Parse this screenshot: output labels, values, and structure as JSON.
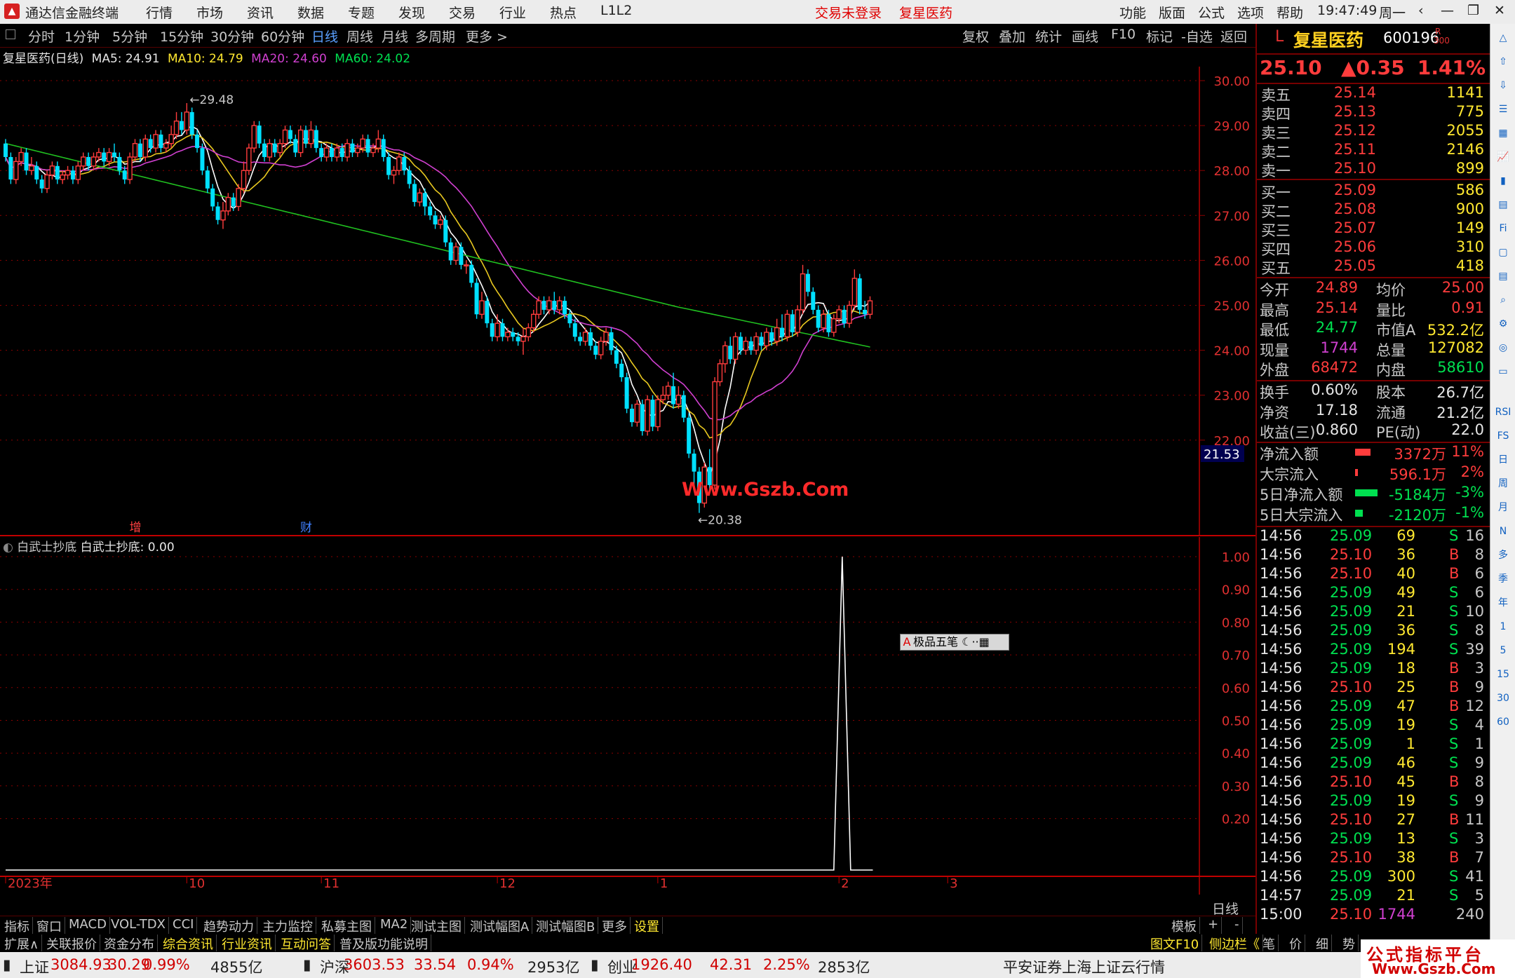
{
  "window": {
    "app_title": "通达信金融终端",
    "menu": [
      "行情",
      "市场",
      "资讯",
      "数据",
      "专题",
      "发现",
      "交易",
      "行业",
      "热点",
      "L1L2"
    ],
    "status_center": [
      "交易未登录",
      "复星医药"
    ],
    "menu_right": [
      "功能",
      "版面",
      "公式",
      "选项",
      "帮助"
    ],
    "time": "19:47:49",
    "weekday": "周一"
  },
  "toolbar": {
    "periods": [
      "分时",
      "1分钟",
      "5分钟",
      "15分钟",
      "30分钟",
      "60分钟",
      "日线",
      "周线",
      "月线",
      "多周期",
      "更多 >"
    ],
    "active_period": "日线",
    "right": [
      "复权",
      "叠加",
      "统计",
      "画线",
      "F10",
      "标记",
      "-自选",
      "返回"
    ]
  },
  "chart_header": {
    "name": "复星医药(日线)",
    "ma5": "MA5: 24.91",
    "ma10": "MA10: 24.79",
    "ma20": "MA20: 24.60",
    "ma60": "MA60: 24.02"
  },
  "indicator_header": {
    "name": "白武士抄底",
    "value": "白武士抄底: 0.00"
  },
  "colors": {
    "up": "#ff3c3c",
    "down": "#00e0ff",
    "ma5": "#ffffff",
    "ma10": "#e8c820",
    "ma20": "#d040d0",
    "ma60": "#20c020",
    "grid": "#8b0000"
  },
  "chart_data": {
    "type": "candlestick",
    "ylim": [
      20.0,
      30.3
    ],
    "y_ticks": [
      "30.00",
      "29.00",
      "28.00",
      "27.00",
      "26.00",
      "25.00",
      "24.00",
      "23.00",
      "22.00"
    ],
    "x_labels": [
      "2023年",
      "10",
      "11",
      "12",
      "1",
      "2",
      "3"
    ],
    "x_label_idx": [
      0,
      35,
      61,
      95,
      126,
      161,
      182
    ],
    "high_label": "29.48",
    "low_label": "20.38",
    "current_price_tag": "21.53",
    "markers": [
      {
        "text": "增",
        "idx": 25
      },
      {
        "text": "财",
        "idx": 58
      }
    ],
    "series_ohlc": [
      [
        28.6,
        28.3,
        28.7,
        28.2
      ],
      [
        28.3,
        27.8,
        28.4,
        27.7
      ],
      [
        27.8,
        28.2,
        28.3,
        27.7
      ],
      [
        28.2,
        28.4,
        28.5,
        28.1
      ],
      [
        28.4,
        28.0,
        28.5,
        27.9
      ],
      [
        28.0,
        28.1,
        28.3,
        27.9
      ],
      [
        28.1,
        27.8,
        28.2,
        27.7
      ],
      [
        27.8,
        27.6,
        27.9,
        27.5
      ],
      [
        27.6,
        27.9,
        28.0,
        27.5
      ],
      [
        27.9,
        28.1,
        28.2,
        27.8
      ],
      [
        28.1,
        27.8,
        28.2,
        27.7
      ],
      [
        27.8,
        27.9,
        28.0,
        27.7
      ],
      [
        27.9,
        28.0,
        28.1,
        27.8
      ],
      [
        28.0,
        27.8,
        28.1,
        27.7
      ],
      [
        27.8,
        28.1,
        28.2,
        27.7
      ],
      [
        28.1,
        28.3,
        28.4,
        28.0
      ],
      [
        28.3,
        28.1,
        28.4,
        28.0
      ],
      [
        28.1,
        28.3,
        28.4,
        28.0
      ],
      [
        28.3,
        28.4,
        28.5,
        28.2
      ],
      [
        28.4,
        28.2,
        28.5,
        28.1
      ],
      [
        28.2,
        28.4,
        28.5,
        28.1
      ],
      [
        28.4,
        28.3,
        28.6,
        28.2
      ],
      [
        28.3,
        28.0,
        28.4,
        27.9
      ],
      [
        28.0,
        27.8,
        28.1,
        27.7
      ],
      [
        27.8,
        28.3,
        28.4,
        27.7
      ],
      [
        28.3,
        28.6,
        28.7,
        28.2
      ],
      [
        28.6,
        28.3,
        28.7,
        28.2
      ],
      [
        28.3,
        28.7,
        28.8,
        28.2
      ],
      [
        28.7,
        28.5,
        28.8,
        28.4
      ],
      [
        28.5,
        28.8,
        28.9,
        28.4
      ],
      [
        28.8,
        28.5,
        28.9,
        28.4
      ],
      [
        28.5,
        28.6,
        28.7,
        28.4
      ],
      [
        28.6,
        28.8,
        29.0,
        28.5
      ],
      [
        28.8,
        29.1,
        29.3,
        28.7
      ],
      [
        29.1,
        28.9,
        29.3,
        28.8
      ],
      [
        28.9,
        29.3,
        29.5,
        28.8
      ],
      [
        29.3,
        28.8,
        29.4,
        28.7
      ],
      [
        28.8,
        28.5,
        28.9,
        28.4
      ],
      [
        28.5,
        28.0,
        28.6,
        27.9
      ],
      [
        28.0,
        27.6,
        28.1,
        27.5
      ],
      [
        27.6,
        27.2,
        27.7,
        27.1
      ],
      [
        27.2,
        26.9,
        27.3,
        26.8
      ],
      [
        26.9,
        27.1,
        27.3,
        26.7
      ],
      [
        27.1,
        27.4,
        27.5,
        27.0
      ],
      [
        27.4,
        27.2,
        27.5,
        27.1
      ],
      [
        27.2,
        27.6,
        27.7,
        27.1
      ],
      [
        27.6,
        28.0,
        28.2,
        27.5
      ],
      [
        28.0,
        28.5,
        28.6,
        27.9
      ],
      [
        28.5,
        29.0,
        29.1,
        28.4
      ],
      [
        29.0,
        28.6,
        29.1,
        28.5
      ],
      [
        28.6,
        28.3,
        28.7,
        28.2
      ],
      [
        28.3,
        28.6,
        28.7,
        28.2
      ],
      [
        28.6,
        28.4,
        28.7,
        28.3
      ],
      [
        28.4,
        28.6,
        28.7,
        28.3
      ],
      [
        28.6,
        28.9,
        29.0,
        28.5
      ],
      [
        28.9,
        28.7,
        29.0,
        28.6
      ],
      [
        28.7,
        28.4,
        28.8,
        28.3
      ],
      [
        28.4,
        28.9,
        29.0,
        28.3
      ],
      [
        28.9,
        28.6,
        29.0,
        28.5
      ],
      [
        28.6,
        28.9,
        29.1,
        28.5
      ],
      [
        28.9,
        28.5,
        29.0,
        28.4
      ],
      [
        28.5,
        28.3,
        28.6,
        28.2
      ],
      [
        28.3,
        28.5,
        28.6,
        28.2
      ],
      [
        28.5,
        28.3,
        28.6,
        28.2
      ],
      [
        28.3,
        28.5,
        28.6,
        28.2
      ],
      [
        28.5,
        28.3,
        28.6,
        28.2
      ],
      [
        28.3,
        28.6,
        28.7,
        28.2
      ],
      [
        28.6,
        28.4,
        28.7,
        28.3
      ],
      [
        28.4,
        28.5,
        28.6,
        28.3
      ],
      [
        28.5,
        28.7,
        28.8,
        28.4
      ],
      [
        28.7,
        28.4,
        28.8,
        28.3
      ],
      [
        28.4,
        28.5,
        28.6,
        28.3
      ],
      [
        28.5,
        28.7,
        28.9,
        28.4
      ],
      [
        28.7,
        28.3,
        28.8,
        28.2
      ],
      [
        28.3,
        27.9,
        28.4,
        27.8
      ],
      [
        27.9,
        28.0,
        28.1,
        27.7
      ],
      [
        28.0,
        28.3,
        28.4,
        27.9
      ],
      [
        28.3,
        28.0,
        28.4,
        27.9
      ],
      [
        28.0,
        27.7,
        28.1,
        27.6
      ],
      [
        27.7,
        27.3,
        27.8,
        27.2
      ],
      [
        27.3,
        27.5,
        27.6,
        27.2
      ],
      [
        27.5,
        27.2,
        27.6,
        27.0
      ],
      [
        27.2,
        27.0,
        27.3,
        26.9
      ],
      [
        27.0,
        26.8,
        27.1,
        26.7
      ],
      [
        26.8,
        26.9,
        27.0,
        26.7
      ],
      [
        26.9,
        26.4,
        27.0,
        26.3
      ],
      [
        26.4,
        26.0,
        26.5,
        25.9
      ],
      [
        26.0,
        26.3,
        26.4,
        25.9
      ],
      [
        26.3,
        25.9,
        26.4,
        25.8
      ],
      [
        25.9,
        25.9,
        26.0,
        25.7
      ],
      [
        25.9,
        25.5,
        26.0,
        25.4
      ],
      [
        25.5,
        24.8,
        25.6,
        24.7
      ],
      [
        24.8,
        25.1,
        25.3,
        24.7
      ],
      [
        25.1,
        24.6,
        25.2,
        24.5
      ],
      [
        24.6,
        24.3,
        24.7,
        24.2
      ],
      [
        24.3,
        24.6,
        24.8,
        24.2
      ],
      [
        24.6,
        24.3,
        24.7,
        24.2
      ],
      [
        24.3,
        24.4,
        24.5,
        24.2
      ],
      [
        24.4,
        24.3,
        24.5,
        24.2
      ],
      [
        24.3,
        24.2,
        24.4,
        24.1
      ],
      [
        24.2,
        24.3,
        24.5,
        23.9
      ],
      [
        24.3,
        24.5,
        24.6,
        24.2
      ],
      [
        24.5,
        24.8,
        24.9,
        24.4
      ],
      [
        24.8,
        25.1,
        25.2,
        24.7
      ],
      [
        25.1,
        24.9,
        25.2,
        24.8
      ],
      [
        24.9,
        25.1,
        25.2,
        24.8
      ],
      [
        25.1,
        24.9,
        25.3,
        24.8
      ],
      [
        24.9,
        25.1,
        25.2,
        24.8
      ],
      [
        25.1,
        24.8,
        25.2,
        24.7
      ],
      [
        24.8,
        24.6,
        24.9,
        24.5
      ],
      [
        24.6,
        24.3,
        24.7,
        24.2
      ],
      [
        24.3,
        24.2,
        24.4,
        24.1
      ],
      [
        24.2,
        24.4,
        24.5,
        24.1
      ],
      [
        24.4,
        24.1,
        24.5,
        24.0
      ],
      [
        24.1,
        23.9,
        24.2,
        23.8
      ],
      [
        23.9,
        24.2,
        24.3,
        23.8
      ],
      [
        24.2,
        24.4,
        24.5,
        24.1
      ],
      [
        24.4,
        24.0,
        24.5,
        23.9
      ],
      [
        24.0,
        23.7,
        24.1,
        23.6
      ],
      [
        23.7,
        23.4,
        23.8,
        23.3
      ],
      [
        23.4,
        22.7,
        23.5,
        22.6
      ],
      [
        22.7,
        22.4,
        22.8,
        22.3
      ],
      [
        22.4,
        22.8,
        22.9,
        22.3
      ],
      [
        22.8,
        22.2,
        22.9,
        22.1
      ],
      [
        22.2,
        22.9,
        23.0,
        22.1
      ],
      [
        22.9,
        22.3,
        23.0,
        22.2
      ],
      [
        22.3,
        22.9,
        23.0,
        22.2
      ],
      [
        22.9,
        23.0,
        23.2,
        22.8
      ],
      [
        23.0,
        23.2,
        23.3,
        22.9
      ],
      [
        23.2,
        22.8,
        23.5,
        22.7
      ],
      [
        22.8,
        23.0,
        23.2,
        22.7
      ],
      [
        23.0,
        22.5,
        23.1,
        22.4
      ],
      [
        22.5,
        21.7,
        22.6,
        21.6
      ],
      [
        21.7,
        21.3,
        21.8,
        20.9
      ],
      [
        21.3,
        20.6,
        21.4,
        20.38
      ],
      [
        20.6,
        21.4,
        21.5,
        20.5
      ],
      [
        21.4,
        21.0,
        21.8,
        20.9
      ],
      [
        21.0,
        23.3,
        23.4,
        20.9
      ],
      [
        23.3,
        23.7,
        23.8,
        23.2
      ],
      [
        23.7,
        24.1,
        24.2,
        23.5
      ],
      [
        24.1,
        23.8,
        24.3,
        23.7
      ],
      [
        23.8,
        24.3,
        24.4,
        23.7
      ],
      [
        24.3,
        24.0,
        24.4,
        23.9
      ],
      [
        24.0,
        24.2,
        24.3,
        23.9
      ],
      [
        24.2,
        24.0,
        24.3,
        23.9
      ],
      [
        24.0,
        24.3,
        24.4,
        23.9
      ],
      [
        24.3,
        24.1,
        24.4,
        24.0
      ],
      [
        24.1,
        24.4,
        24.5,
        24.0
      ],
      [
        24.4,
        24.2,
        24.5,
        24.1
      ],
      [
        24.2,
        24.5,
        24.7,
        24.1
      ],
      [
        24.5,
        24.3,
        24.8,
        24.2
      ],
      [
        24.3,
        24.8,
        24.9,
        24.2
      ],
      [
        24.8,
        24.4,
        24.9,
        24.3
      ],
      [
        24.4,
        24.9,
        25.0,
        24.3
      ],
      [
        24.9,
        25.7,
        25.9,
        24.8
      ],
      [
        25.7,
        25.3,
        25.8,
        25.2
      ],
      [
        25.3,
        24.9,
        25.4,
        24.8
      ],
      [
        24.9,
        24.5,
        25.0,
        24.4
      ],
      [
        24.5,
        24.8,
        24.9,
        24.4
      ],
      [
        24.8,
        24.4,
        24.9,
        24.3
      ],
      [
        24.4,
        24.7,
        24.8,
        24.3
      ],
      [
        24.7,
        24.9,
        25.0,
        24.6
      ],
      [
        24.9,
        24.6,
        25.0,
        24.5
      ],
      [
        24.6,
        25.0,
        25.1,
        24.5
      ],
      [
        25.0,
        25.6,
        25.8,
        24.9
      ],
      [
        25.6,
        24.9,
        25.7,
        24.8
      ],
      [
        24.9,
        24.8,
        25.1,
        24.7
      ],
      [
        24.8,
        25.1,
        25.2,
        24.7
      ]
    ],
    "indicator": {
      "name": "白武士抄底",
      "ylim": [
        0,
        1.08
      ],
      "y_ticks": [
        "1.00",
        "0.90",
        "0.80",
        "0.70",
        "0.60",
        "0.50",
        "0.40",
        "0.30",
        "0.20"
      ],
      "spike_idx": 160,
      "spike_value": 1.0
    }
  },
  "quote": {
    "exchange_tag": "L",
    "name": "复星医药",
    "code": "600196",
    "code_suffix": "R",
    "code_suffix2": "300",
    "price": "25.10",
    "change": "▲0.35",
    "pct": "1.41%",
    "asks": [
      [
        "卖五",
        "25.14",
        "1141"
      ],
      [
        "卖四",
        "25.13",
        "775"
      ],
      [
        "卖三",
        "25.12",
        "2055"
      ],
      [
        "卖二",
        "25.11",
        "2146"
      ],
      [
        "卖一",
        "25.10",
        "899"
      ]
    ],
    "bids": [
      [
        "买一",
        "25.09",
        "586"
      ],
      [
        "买二",
        "25.08",
        "900"
      ],
      [
        "买三",
        "25.07",
        "149"
      ],
      [
        "买四",
        "25.06",
        "310"
      ],
      [
        "买五",
        "25.05",
        "418"
      ]
    ],
    "stats": [
      [
        "今开",
        "24.89",
        "均价",
        "25.00"
      ],
      [
        "最高",
        "25.14",
        "量比",
        "0.91"
      ],
      [
        "最低",
        "24.77",
        "市值A",
        "532.2亿"
      ],
      [
        "现量",
        "1744",
        "总量",
        "127082"
      ],
      [
        "外盘",
        "68472",
        "内盘",
        "58610"
      ]
    ],
    "stats2": [
      [
        "换手",
        "0.60%",
        "股本",
        "26.7亿"
      ],
      [
        "净资",
        "17.18",
        "流通",
        "21.2亿"
      ],
      [
        "收益(三)",
        "0.860",
        "PE(动)",
        "22.0"
      ]
    ],
    "flows": [
      [
        "净流入额",
        "3372万",
        "11%",
        "up",
        0.6
      ],
      [
        "大宗流入",
        "596.1万",
        "2%",
        "up",
        0.1
      ],
      [
        "5日净流入额",
        "-5184万",
        "-3%",
        "dn",
        0.9
      ],
      [
        "5日大宗流入",
        "-2120万",
        "-1%",
        "dn",
        0.3
      ]
    ],
    "ticks": [
      [
        "14:56",
        "25.09",
        "69",
        "S",
        "16"
      ],
      [
        "14:56",
        "25.10",
        "36",
        "B",
        "8"
      ],
      [
        "14:56",
        "25.10",
        "40",
        "B",
        "6"
      ],
      [
        "14:56",
        "25.09",
        "49",
        "S",
        "6"
      ],
      [
        "14:56",
        "25.09",
        "21",
        "S",
        "10"
      ],
      [
        "14:56",
        "25.09",
        "36",
        "S",
        "8"
      ],
      [
        "14:56",
        "25.09",
        "194",
        "S",
        "39"
      ],
      [
        "14:56",
        "25.09",
        "18",
        "B",
        "3"
      ],
      [
        "14:56",
        "25.10",
        "25",
        "B",
        "9"
      ],
      [
        "14:56",
        "25.09",
        "47",
        "B",
        "12"
      ],
      [
        "14:56",
        "25.09",
        "19",
        "S",
        "4"
      ],
      [
        "14:56",
        "25.09",
        "1",
        "S",
        "1"
      ],
      [
        "14:56",
        "25.09",
        "46",
        "S",
        "9"
      ],
      [
        "14:56",
        "25.10",
        "45",
        "B",
        "8"
      ],
      [
        "14:56",
        "25.09",
        "19",
        "S",
        "9"
      ],
      [
        "14:56",
        "25.10",
        "27",
        "B",
        "11"
      ],
      [
        "14:56",
        "25.09",
        "13",
        "S",
        "3"
      ],
      [
        "14:56",
        "25.10",
        "38",
        "B",
        "7"
      ],
      [
        "14:56",
        "25.09",
        "300",
        "S",
        "41"
      ],
      [
        "14:57",
        "25.09",
        "21",
        "S",
        "5"
      ],
      [
        "15:00",
        "25.10",
        "1744",
        "",
        "240"
      ]
    ]
  },
  "bottom_tabs": [
    "指标",
    "窗口",
    "MACD",
    "VOL-TDX",
    "CCI",
    "趋势动力",
    "主力监控",
    "私募主图",
    "MA2",
    "测试主图",
    "测试幅图A",
    "测试幅图B",
    "更多",
    "设置"
  ],
  "bottom_tabs_right": [
    "模板",
    "+",
    "-"
  ],
  "period_label": "日线",
  "bottom_tabs2": [
    "扩展∧",
    "关联报价",
    "资金分布",
    "综合资讯",
    "行业资讯",
    "互动问答",
    "普及版功能说明"
  ],
  "bottom_tabs2_right": [
    "图文F10",
    "侧边栏《",
    "笔",
    "价",
    "细",
    "势"
  ],
  "indices": [
    {
      "name": "上证",
      "value": "3084.93",
      "chg": "30.29",
      "pct": "0.99%",
      "amt": "4855亿"
    },
    {
      "name": "沪深",
      "value": "3603.53",
      "chg": "33.54",
      "pct": "0.94%",
      "amt": "2953亿"
    },
    {
      "name": "创业",
      "value": "1926.40",
      "chg": "42.31",
      "pct": "2.25%",
      "amt": "2853亿"
    }
  ],
  "status_msg": "平安证券上海上证云行情",
  "watermark": "Www.Gszb.Com",
  "popup_label": "极品五笔",
  "brand": {
    "line1": "公式指标平台",
    "line2": "Www.Gszb.Com"
  },
  "sidebar_labels": [
    "RSI",
    "FS",
    "日",
    "周",
    "月",
    "N",
    "多",
    "季",
    "年",
    "1",
    "5",
    "15",
    "30",
    "60"
  ]
}
